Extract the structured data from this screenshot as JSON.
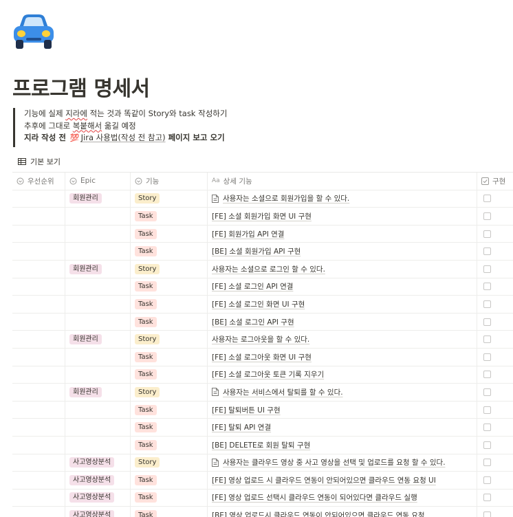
{
  "page": {
    "icon": "car-icon",
    "title": "프로그램 명세서"
  },
  "callout": {
    "line1_a": "기능에 실제 ",
    "line1_b": "지라에",
    "line1_c": " 적는 것과 똑같이 Story와 task 작성하기",
    "line2_a": "추후에 그대로 ",
    "line2_b": "복붙해서",
    "line2_c": " 옮길 예정",
    "line3_a": "지라 작성 전 ",
    "line3_icon": "💯",
    "line3_link": "Jira 사용법(작성 전 참고)",
    "line3_b": " 페이지 보고 오기"
  },
  "view": {
    "label": "기본 보기",
    "icon": "table-icon"
  },
  "table": {
    "headers": {
      "priority": "우선순위",
      "epic": "Epic",
      "feature": "기능",
      "title_prefix": "Aa",
      "detail": "상세 기능",
      "done": "구현"
    },
    "rows": [
      {
        "epic": "회원관리",
        "type": "Story",
        "detail": "사용자는 소셜으로 회원가입을 할 수 있다.",
        "doc": true
      },
      {
        "epic": "",
        "type": "Task",
        "detail": "[FE] 소셜 회원가입 화면 UI 구현",
        "doc": false
      },
      {
        "epic": "",
        "type": "Task",
        "detail": "[FE] 회원가입 API 연결",
        "doc": false
      },
      {
        "epic": "",
        "type": "Task",
        "detail": "[BE] 소셜 회원가입 API 구현",
        "doc": false
      },
      {
        "epic": "회원관리",
        "type": "Story",
        "detail": "사용자는 소셜으로 로그인 할 수 있다.",
        "doc": false
      },
      {
        "epic": "",
        "type": "Task",
        "detail": "[FE] 소셜 로그인 API 연결",
        "doc": false
      },
      {
        "epic": "",
        "type": "Task",
        "detail": "[FE] 소셜 로그인 화면 UI 구현",
        "doc": false
      },
      {
        "epic": "",
        "type": "Task",
        "detail": "[BE] 소셜 로그인 API 구현",
        "doc": false
      },
      {
        "epic": "회원관리",
        "type": "Story",
        "detail": "사용자는 로그아웃을 할 수 있다.",
        "doc": false
      },
      {
        "epic": "",
        "type": "Task",
        "detail": "[FE] 소셜 로그아웃 화면 UI 구현",
        "doc": false
      },
      {
        "epic": "",
        "type": "Task",
        "detail": "[FE] 소셜 로그아웃 토큰 기록 지우기",
        "doc": false
      },
      {
        "epic": "회원관리",
        "type": "Story",
        "detail": "사용자는 서비스에서 탈퇴를 할 수 있다.",
        "doc": true
      },
      {
        "epic": "",
        "type": "Task",
        "detail": "[FE] 탈퇴버튼 UI 구현",
        "doc": false
      },
      {
        "epic": "",
        "type": "Task",
        "detail": "[FE] 탈퇴 API 연결",
        "doc": false
      },
      {
        "epic": "",
        "type": "Task",
        "detail": "[BE] DELETE로 회원 탈퇴 구현",
        "doc": false
      },
      {
        "epic": "사고영상분석",
        "type": "Story",
        "detail": "사용자는 클라우드 영상 중 사고 영상을 선택 및 업로드를 요청 할 수 있다.",
        "doc": true
      },
      {
        "epic": "사고영상분석",
        "type": "Task",
        "detail": "[FE] 영상 업로드 시 클라우드 연동이 안되어있으면 클라우드 연동 요청 UI",
        "doc": false
      },
      {
        "epic": "사고영상분석",
        "type": "Task",
        "detail": "[FE] 영상 업로드 선택시 클라우드 연동이 되어있다면 클라우드 실행",
        "doc": false
      },
      {
        "epic": "사고영상분석",
        "type": "Task",
        "detail": "[BE] 영상 업로드시 클라우드 연동이 안되어있으면 클라우드 연동 요청",
        "doc": false
      }
    ]
  }
}
